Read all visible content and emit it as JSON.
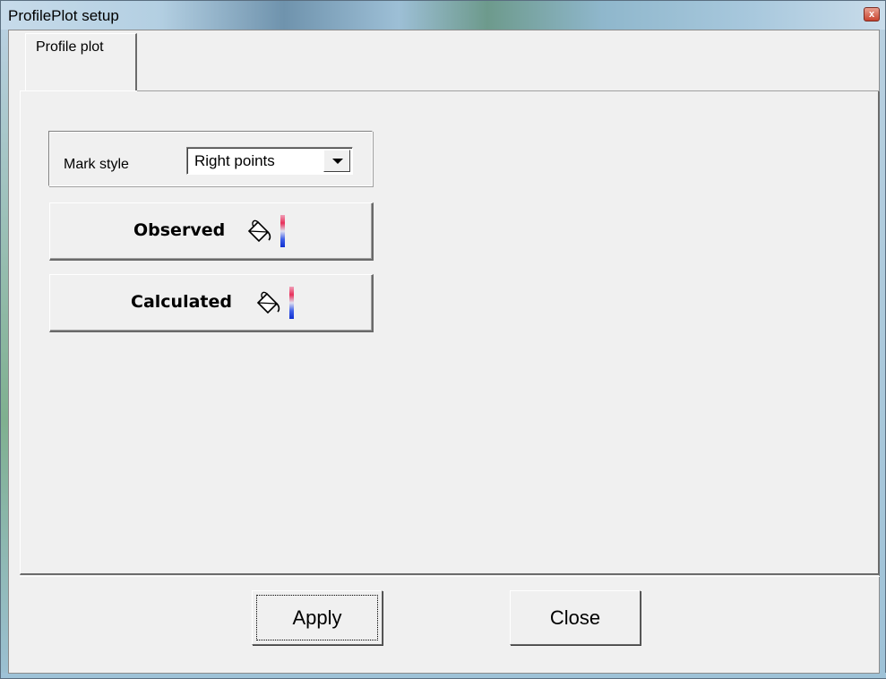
{
  "window": {
    "title": "ProfilePlot setup",
    "close_glyph": "x"
  },
  "tabs": [
    {
      "label": "Profile plot",
      "selected": true
    }
  ],
  "mark_style": {
    "label": "Mark style",
    "selected_value": "Right points"
  },
  "color_buttons": {
    "observed": {
      "label": "Observed",
      "icon": "paint-bucket-icon"
    },
    "calculated": {
      "label": "Calculated",
      "icon": "paint-bucket-icon"
    }
  },
  "buttons": {
    "apply": "Apply",
    "close": "Close"
  }
}
